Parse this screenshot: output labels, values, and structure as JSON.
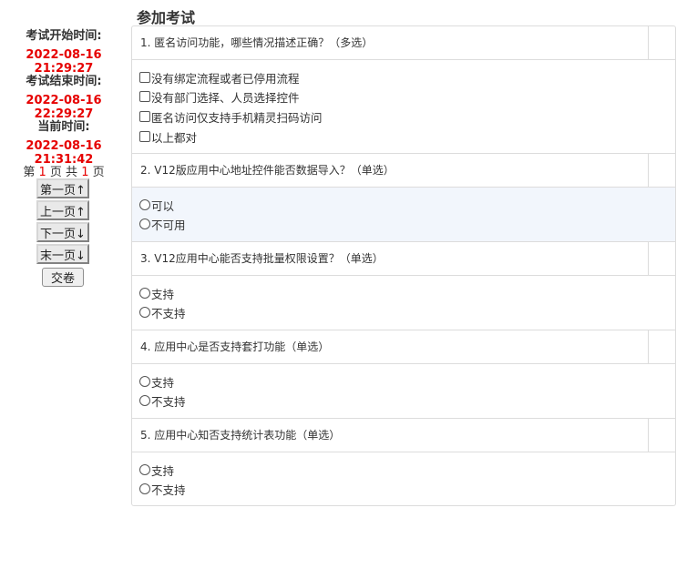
{
  "sidebar": {
    "start_label": "考试开始时间:",
    "start_time": "2022-08-16 21:29:27",
    "end_label": "考试结束时间:",
    "end_time": "2022-08-16 22:29:27",
    "now_label": "当前时间:",
    "now_time": "2022-08-16 21:31:42",
    "pager": {
      "prefix": "第 ",
      "current": "1",
      "mid": " 页 共 ",
      "total": "1",
      "suffix": " 页"
    },
    "first_label": "第一页↑",
    "prev_label": "上一页↑",
    "next_label": "下一页↓",
    "last_label": "末一页↓",
    "submit_label": "交卷"
  },
  "page_title": "参加考试",
  "questions": [
    {
      "text": "1. 匿名访问功能，哪些情况描述正确？（多选）",
      "options": [
        "没有绑定流程或者已停用流程",
        "没有部门选择、人员选择控件",
        "匿名访问仅支持手机精灵扫码访问",
        "以上都对"
      ]
    },
    {
      "text": "2. V12版应用中心地址控件能否数据导入？（单选）",
      "options": [
        "可以",
        "不可用"
      ]
    },
    {
      "text": "3. V12应用中心能否支持批量权限设置？（单选）",
      "options": [
        "支持",
        "不支持"
      ]
    },
    {
      "text": "4. 应用中心是否支持套打功能（单选）",
      "options": [
        "支持",
        "不支持"
      ]
    },
    {
      "text": "5. 应用中心知否支持统计表功能（单选）",
      "options": [
        "支持",
        "不支持"
      ]
    }
  ]
}
